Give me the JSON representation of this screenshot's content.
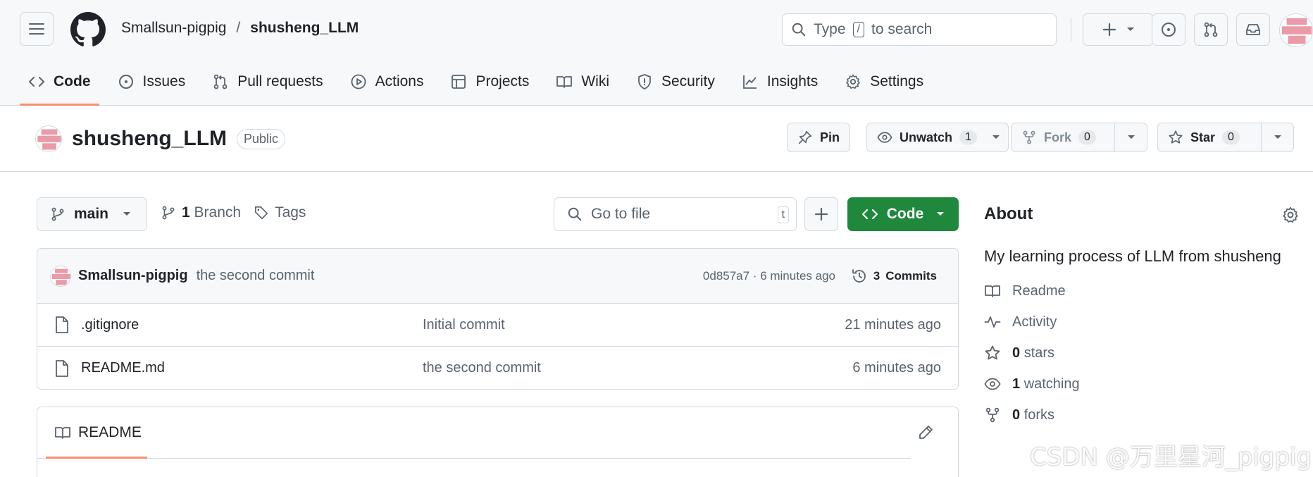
{
  "breadcrumb": {
    "owner": "Smallsun-pigpig",
    "separator": "/",
    "repo": "shusheng_LLM"
  },
  "search": {
    "prefix": "Type",
    "key": "/",
    "suffix": "to search"
  },
  "tabs": [
    {
      "label": "Code",
      "icon": "code-icon"
    },
    {
      "label": "Issues",
      "icon": "issue-icon"
    },
    {
      "label": "Pull requests",
      "icon": "pull-request-icon"
    },
    {
      "label": "Actions",
      "icon": "play-icon"
    },
    {
      "label": "Projects",
      "icon": "table-icon"
    },
    {
      "label": "Wiki",
      "icon": "book-icon"
    },
    {
      "label": "Security",
      "icon": "shield-icon"
    },
    {
      "label": "Insights",
      "icon": "graph-icon"
    },
    {
      "label": "Settings",
      "icon": "gear-icon"
    }
  ],
  "repo": {
    "name": "shusheng_LLM",
    "visibility": "Public"
  },
  "actions": {
    "pin": "Pin",
    "watch": {
      "label": "Unwatch",
      "count": "1"
    },
    "fork": {
      "label": "Fork",
      "count": "0"
    },
    "star": {
      "label": "Star",
      "count": "0"
    }
  },
  "branch": {
    "name": "main",
    "branch_count": "1",
    "branch_label": "Branch",
    "tags_label": "Tags"
  },
  "goto_file": {
    "placeholder": "Go to file",
    "key": "t"
  },
  "code_button": "Code",
  "latest_commit": {
    "author": "Smallsun-pigpig",
    "message": "the second commit",
    "sha_time": "0d857a7 · 6 minutes ago",
    "commits_count": "3",
    "commits_label": "Commits"
  },
  "files": [
    {
      "name": ".gitignore",
      "message": "Initial commit",
      "time": "21 minutes ago"
    },
    {
      "name": "README.md",
      "message": "the second commit",
      "time": "6 minutes ago"
    }
  ],
  "readme": {
    "tab_label": "README"
  },
  "about": {
    "title": "About",
    "description": "My learning process of LLM from shusheng",
    "items": [
      {
        "icon": "book-icon",
        "value": "",
        "label": "Readme"
      },
      {
        "icon": "pulse-icon",
        "value": "",
        "label": "Activity"
      },
      {
        "icon": "star-icon",
        "value": "0",
        "label": "stars"
      },
      {
        "icon": "eye-icon",
        "value": "1",
        "label": "watching"
      },
      {
        "icon": "fork-icon",
        "value": "0",
        "label": "forks"
      }
    ]
  },
  "watermark": "CSDN @万里星河_pigpig",
  "colors": {
    "accent_underline": "#fd8c73",
    "code_button": "#1f883d",
    "muted_text": "#59636e",
    "border": "#d1d9e0"
  }
}
